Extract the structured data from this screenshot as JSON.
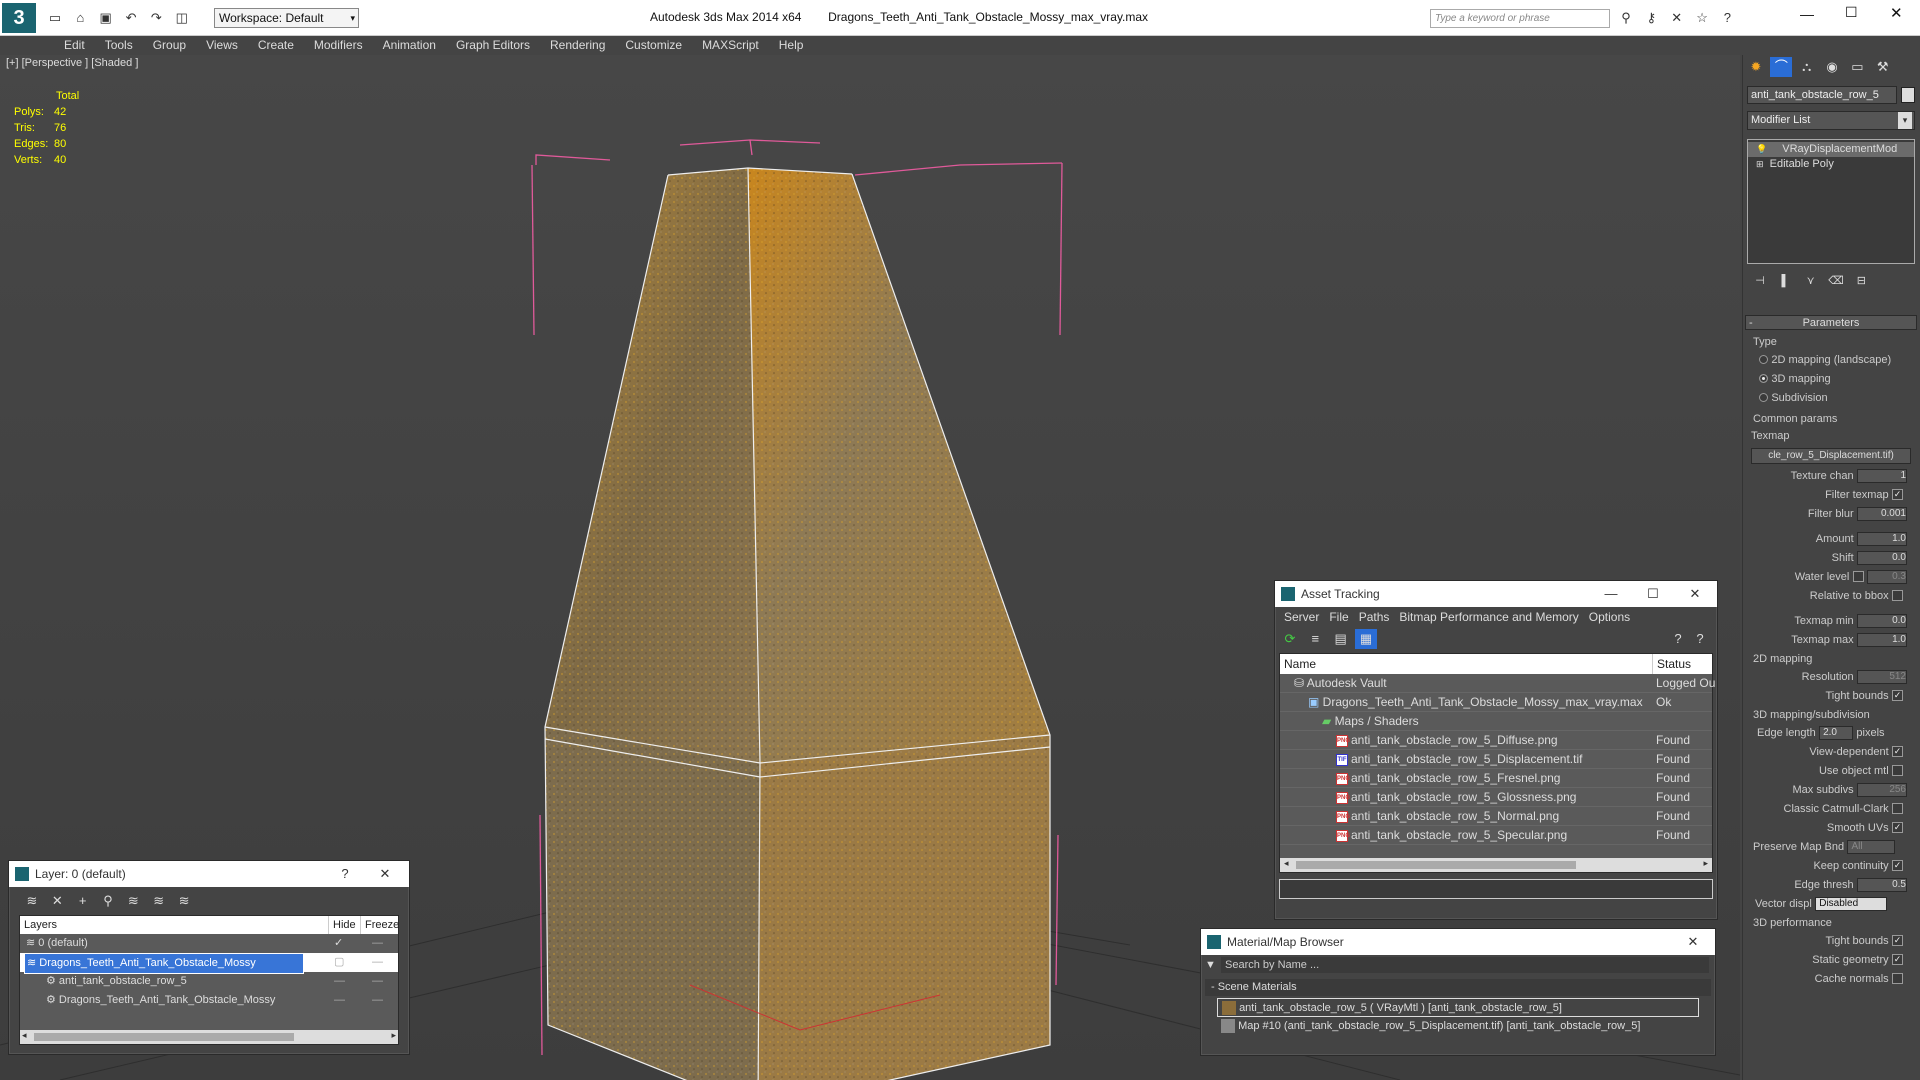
{
  "titlebar": {
    "workspace": "Workspace: Default",
    "app_title": "Autodesk 3ds Max  2014 x64",
    "file_name": "Dragons_Teeth_Anti_Tank_Obstacle_Mossy_max_vray.max",
    "search_placeholder": "Type a keyword or phrase"
  },
  "menu": [
    "Edit",
    "Tools",
    "Group",
    "Views",
    "Create",
    "Modifiers",
    "Animation",
    "Graph Editors",
    "Rendering",
    "Customize",
    "MAXScript",
    "Help"
  ],
  "viewport": {
    "label": "[+] [Perspective ] [Shaded ]",
    "stats": {
      "header": "Total",
      "rows": [
        {
          "label": "Polys:",
          "value": "42"
        },
        {
          "label": "Tris:",
          "value": "76"
        },
        {
          "label": "Edges:",
          "value": "80"
        },
        {
          "label": "Verts:",
          "value": "40"
        }
      ]
    }
  },
  "command_panel": {
    "object_name": "anti_tank_obstacle_row_5",
    "modifier_list": "Modifier List",
    "stack": [
      "VRayDisplacementMod",
      "Editable Poly"
    ],
    "params_title": "Parameters",
    "type_label": "Type",
    "type_options": [
      {
        "label": "2D mapping (landscape)",
        "on": false
      },
      {
        "label": "3D mapping",
        "on": true
      },
      {
        "label": "Subdivision",
        "on": false
      }
    ],
    "common_params": "Common params",
    "texmap_label": "Texmap",
    "texmap_value": "cle_row_5_Displacement.tif)",
    "texture_chan": {
      "label": "Texture chan",
      "value": "1"
    },
    "filter_texmap": "Filter texmap",
    "filter_blur": {
      "label": "Filter blur",
      "value": "0.001"
    },
    "amount": {
      "label": "Amount",
      "value": "1.0"
    },
    "shift": {
      "label": "Shift",
      "value": "0.0"
    },
    "water_level": {
      "label": "Water level",
      "value": "0.3"
    },
    "relative_bbox": "Relative to bbox",
    "texmap_min": {
      "label": "Texmap min",
      "value": "0.0"
    },
    "texmap_max": {
      "label": "Texmap max",
      "value": "1.0"
    },
    "mapping2d": "2D mapping",
    "resolution": {
      "label": "Resolution",
      "value": "512"
    },
    "tight_bounds": "Tight bounds",
    "mapping3d": "3D mapping/subdivision",
    "edge_length": {
      "label": "Edge length",
      "value": "2.0",
      "unit": "pixels"
    },
    "view_dependent": "View-dependent",
    "use_object_mtl": "Use object mtl",
    "max_subdivs": {
      "label": "Max subdivs",
      "value": "256"
    },
    "catmull": "Classic Catmull-Clark",
    "smooth_uvs": "Smooth UVs",
    "preserve_map": {
      "label": "Preserve Map Bnd",
      "value": "All"
    },
    "keep_continuity": "Keep continuity",
    "edge_thresh": {
      "label": "Edge thresh",
      "value": "0.5"
    },
    "vector_displ": {
      "label": "Vector displ",
      "value": "Disabled"
    },
    "perf3d": "3D performance",
    "tight_bounds2": "Tight bounds",
    "static_geometry": "Static geometry",
    "cache_normals": "Cache normals"
  },
  "layers": {
    "title": "Layer: 0 (default)",
    "help": "?",
    "col_layers": "Layers",
    "col_hide": "Hide",
    "col_freeze": "Freeze",
    "rows": [
      {
        "name": "0 (default)",
        "indent": 1,
        "selected": false
      },
      {
        "name": "Dragons_Teeth_Anti_Tank_Obstacle_Mossy",
        "indent": 1,
        "selected": true
      },
      {
        "name": "anti_tank_obstacle_row_5",
        "indent": 2,
        "selected": false
      },
      {
        "name": "Dragons_Teeth_Anti_Tank_Obstacle_Mossy",
        "indent": 2,
        "selected": false
      }
    ]
  },
  "asset_tracking": {
    "title": "Asset Tracking",
    "menu": [
      "Server",
      "File",
      "Paths",
      "Bitmap Performance and Memory",
      "Options"
    ],
    "col_name": "Name",
    "col_status": "Status",
    "rows": [
      {
        "name": "Autodesk Vault",
        "status": "Logged Ou",
        "indent": 1,
        "ico": "vault"
      },
      {
        "name": "Dragons_Teeth_Anti_Tank_Obstacle_Mossy_max_vray.max",
        "status": "Ok",
        "indent": 2,
        "ico": "max"
      },
      {
        "name": "Maps / Shaders",
        "status": "",
        "indent": 3,
        "ico": "folder"
      },
      {
        "name": "anti_tank_obstacle_row_5_Diffuse.png",
        "status": "Found",
        "indent": 4,
        "ico": "png"
      },
      {
        "name": "anti_tank_obstacle_row_5_Displacement.tif",
        "status": "Found",
        "indent": 4,
        "ico": "tif"
      },
      {
        "name": "anti_tank_obstacle_row_5_Fresnel.png",
        "status": "Found",
        "indent": 4,
        "ico": "png"
      },
      {
        "name": "anti_tank_obstacle_row_5_Glossness.png",
        "status": "Found",
        "indent": 4,
        "ico": "png"
      },
      {
        "name": "anti_tank_obstacle_row_5_Normal.png",
        "status": "Found",
        "indent": 4,
        "ico": "png"
      },
      {
        "name": "anti_tank_obstacle_row_5_Specular.png",
        "status": "Found",
        "indent": 4,
        "ico": "png"
      }
    ]
  },
  "material_browser": {
    "title": "Material/Map Browser",
    "search": "Search by Name ...",
    "section": "- Scene Materials",
    "items": [
      "anti_tank_obstacle_row_5  ( VRayMtl ) [anti_tank_obstacle_row_5]",
      "Map #10 (anti_tank_obstacle_row_5_Displacement.tif) [anti_tank_obstacle_row_5]"
    ]
  },
  "colors": {
    "accent": "#3875d7",
    "bbox": "#e05a9a",
    "found": "#dddddd"
  }
}
